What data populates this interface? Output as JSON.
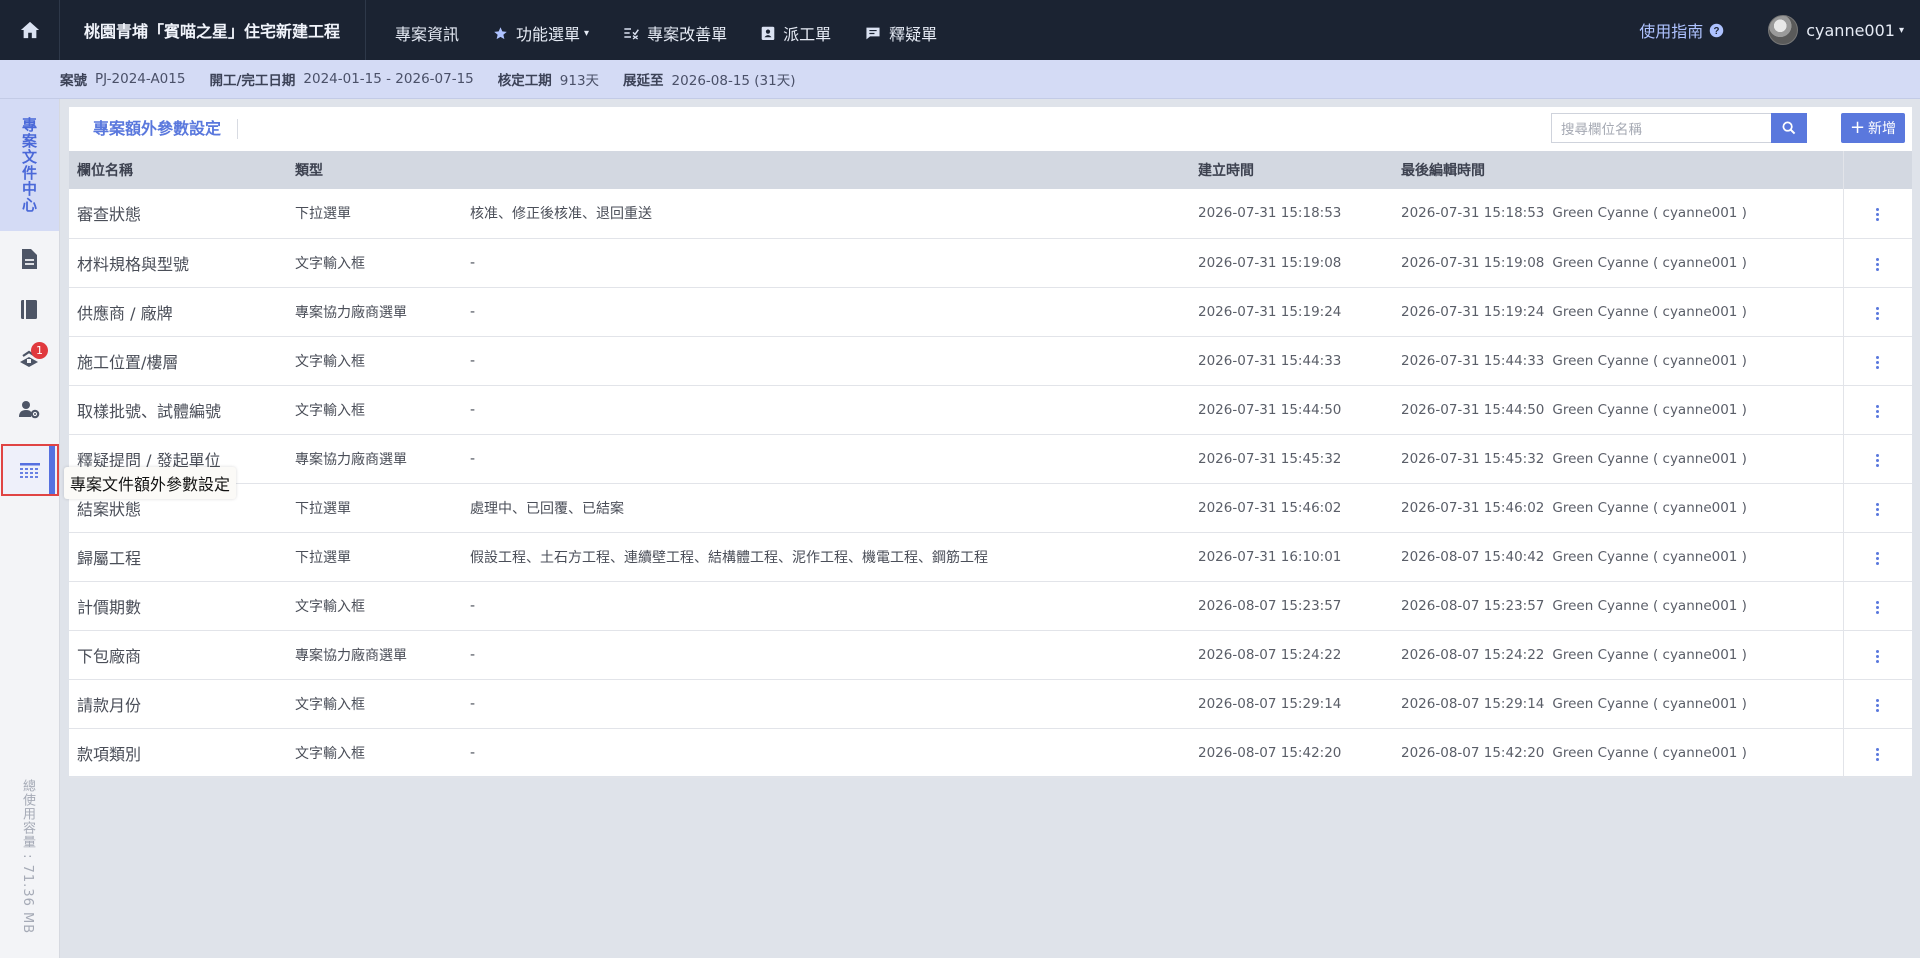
{
  "topnav": {
    "project_title": "桃園青埔「賓喵之星」住宅新建工程",
    "items": [
      {
        "label": "專案資訊",
        "icon": "none"
      },
      {
        "label": "功能選單",
        "icon": "star-icon"
      },
      {
        "label": "專案改善單",
        "icon": "checklist-icon"
      },
      {
        "label": "派工單",
        "icon": "id-card-icon"
      },
      {
        "label": "釋疑單",
        "icon": "chat-icon"
      }
    ],
    "guide_label": "使用指南",
    "username": "cyanne001"
  },
  "infobar": {
    "case_label": "案號",
    "case_value": "PJ-2024-A015",
    "dates_label": "開工/完工日期",
    "dates_value": "2024-01-15 - 2026-07-15",
    "duration_label": "核定工期",
    "duration_value": "913天",
    "extend_label": "展延至",
    "extend_value": "2026-08-15 (31天)"
  },
  "sidebar": {
    "doc_center": "專案文件中心",
    "badge_count": "1",
    "usage": "總使用容量 : 71.36 MB",
    "tooltip": "專案文件額外參數設定"
  },
  "panel": {
    "title": "專案額外參數設定",
    "search_placeholder": "搜尋欄位名稱",
    "add_label": "新增",
    "columns": {
      "name": "欄位名稱",
      "type": "類型",
      "created": "建立時間",
      "edited": "最後編輯時間"
    },
    "rows": [
      {
        "name": "審查狀態",
        "type": "下拉選單",
        "options": "核准、修正後核准、退回重送",
        "created": "2026-07-31 15:18:53",
        "edited": "2026-07-31 15:18:53",
        "editor": "Green Cyanne ( cyanne001 )"
      },
      {
        "name": "材料規格與型號",
        "type": "文字輸入框",
        "options": "-",
        "created": "2026-07-31 15:19:08",
        "edited": "2026-07-31 15:19:08",
        "editor": "Green Cyanne ( cyanne001 )"
      },
      {
        "name": "供應商 / 廠牌",
        "type": "專案協力廠商選單",
        "options": "-",
        "created": "2026-07-31 15:19:24",
        "edited": "2026-07-31 15:19:24",
        "editor": "Green Cyanne ( cyanne001 )"
      },
      {
        "name": "施工位置/樓層",
        "type": "文字輸入框",
        "options": "-",
        "created": "2026-07-31 15:44:33",
        "edited": "2026-07-31 15:44:33",
        "editor": "Green Cyanne ( cyanne001 )"
      },
      {
        "name": "取樣批號、試體編號",
        "type": "文字輸入框",
        "options": "-",
        "created": "2026-07-31 15:44:50",
        "edited": "2026-07-31 15:44:50",
        "editor": "Green Cyanne ( cyanne001 )"
      },
      {
        "name": "釋疑提問 / 發起單位",
        "type": "專案協力廠商選單",
        "options": "-",
        "created": "2026-07-31 15:45:32",
        "edited": "2026-07-31 15:45:32",
        "editor": "Green Cyanne ( cyanne001 )"
      },
      {
        "name": "結案狀態",
        "type": "下拉選單",
        "options": "處理中、已回覆、已結案",
        "created": "2026-07-31 15:46:02",
        "edited": "2026-07-31 15:46:02",
        "editor": "Green Cyanne ( cyanne001 )"
      },
      {
        "name": "歸屬工程",
        "type": "下拉選單",
        "options": "假設工程、土石方工程、連續壁工程、結構體工程、泥作工程、機電工程、鋼筋工程",
        "created": "2026-07-31 16:10:01",
        "edited": "2026-08-07 15:40:42",
        "editor": "Green Cyanne ( cyanne001 )"
      },
      {
        "name": "計價期數",
        "type": "文字輸入框",
        "options": "-",
        "created": "2026-08-07 15:23:57",
        "edited": "2026-08-07 15:23:57",
        "editor": "Green Cyanne ( cyanne001 )"
      },
      {
        "name": "下包廠商",
        "type": "專案協力廠商選單",
        "options": "-",
        "created": "2026-08-07 15:24:22",
        "edited": "2026-08-07 15:24:22",
        "editor": "Green Cyanne ( cyanne001 )"
      },
      {
        "name": "請款月份",
        "type": "文字輸入框",
        "options": "-",
        "created": "2026-08-07 15:29:14",
        "edited": "2026-08-07 15:29:14",
        "editor": "Green Cyanne ( cyanne001 )"
      },
      {
        "name": "款項類別",
        "type": "文字輸入框",
        "options": "-",
        "created": "2026-08-07 15:42:20",
        "edited": "2026-08-07 15:42:20",
        "editor": "Green Cyanne ( cyanne001 )"
      }
    ]
  },
  "colors": {
    "nav_bg": "#1b2332",
    "accent": "#5a78dd",
    "infobar_bg": "#d4dbf5",
    "badge": "#e0393e"
  }
}
